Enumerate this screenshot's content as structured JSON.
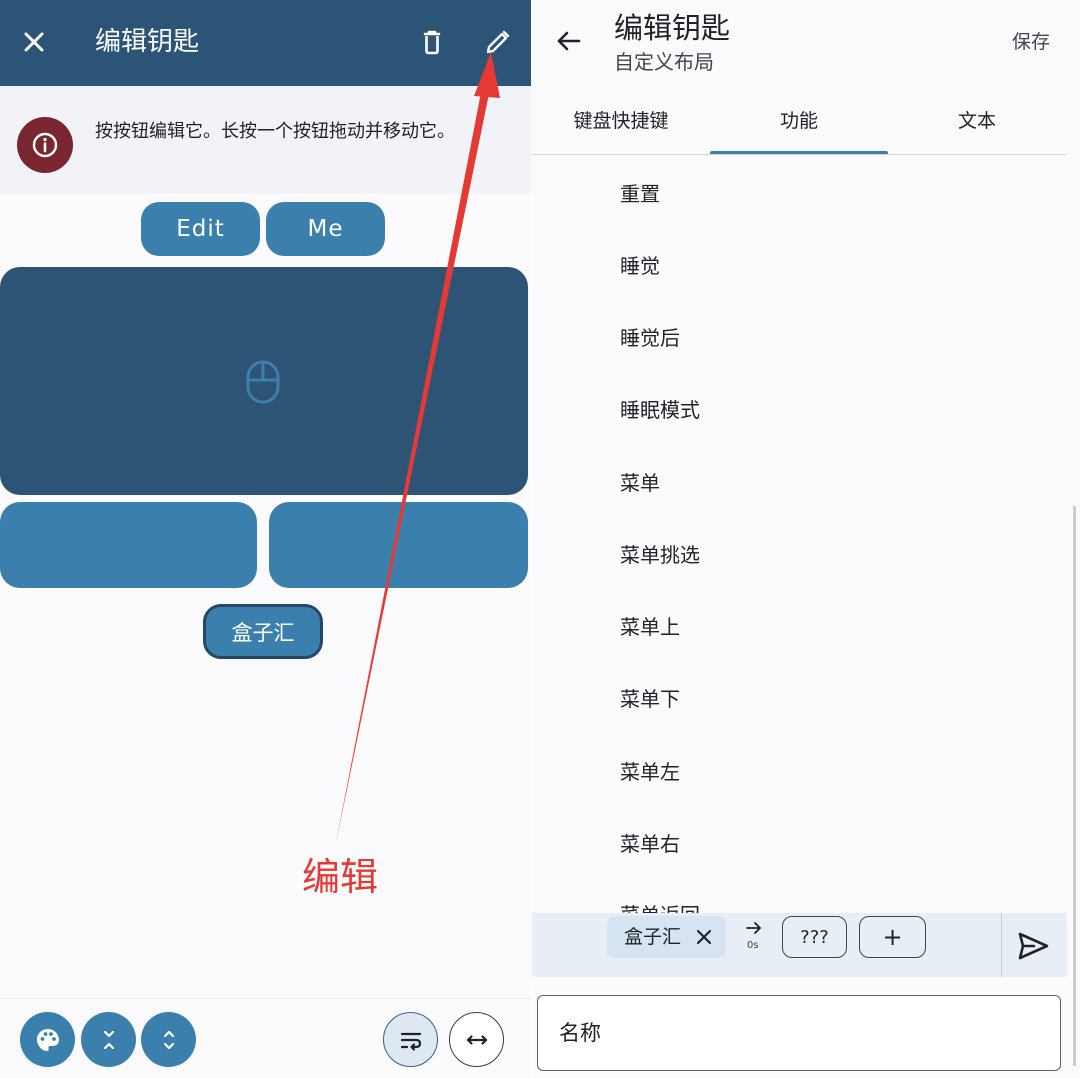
{
  "left_panel": {
    "title": "编辑钥匙",
    "info_text": "按按钮编辑它。长按一个按钮拖动并移动它。",
    "buttons": {
      "edit": "Edit",
      "me": "Me"
    },
    "key_label": "盒子汇",
    "annotation": "编辑",
    "icons": [
      "close-icon",
      "delete-icon",
      "pencil-icon",
      "info-icon",
      "mouse-icon",
      "palette-icon",
      "collapse-icon",
      "expand-icon",
      "wrap-text-icon",
      "width-icon"
    ]
  },
  "right_panel": {
    "title": "编辑钥匙",
    "subtitle": "自定义布局",
    "save_label": "保存",
    "tabs": [
      {
        "label": "键盘快捷键"
      },
      {
        "label": "功能"
      },
      {
        "label": "文本"
      }
    ],
    "active_tab": 1,
    "functions": [
      "重置",
      "睡觉",
      "睡觉后",
      "睡眠模式",
      "菜单",
      "菜单挑选",
      "菜单上",
      "菜单下",
      "菜单左",
      "菜单右",
      "菜单返回"
    ],
    "macro": {
      "chip_label": "盒子汇",
      "delay": "0s",
      "unknown_label": "???",
      "add_label": "+"
    },
    "name_field_label": "名称"
  },
  "colors": {
    "primary_dark": "#2c5477",
    "primary": "#3b80ad",
    "info_badge": "#7a2630",
    "annotation_red": "#e53935"
  }
}
